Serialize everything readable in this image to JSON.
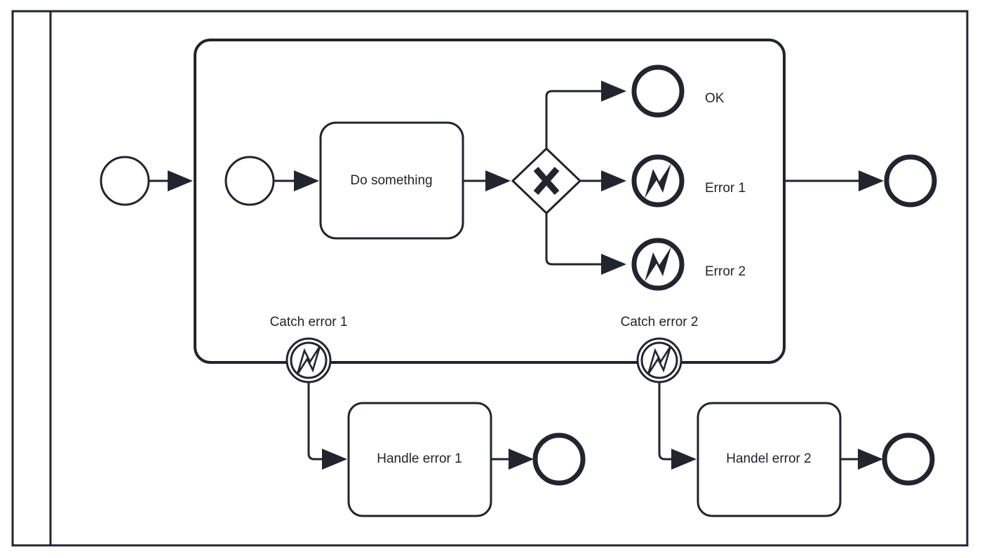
{
  "diagram": {
    "type": "bpmn-process-diagram",
    "notation": "BPMN 2.0",
    "stroke_color": "#22242e",
    "fill_color": "#ffffff",
    "background": "#ffffff"
  },
  "pool": {
    "name": "pool",
    "lane_label": "",
    "has_lane_header": true
  },
  "subprocess": {
    "name": "embedded-subprocess",
    "label": ""
  },
  "events": {
    "outer_start": {
      "label": "",
      "kind": "start-event"
    },
    "sub_start": {
      "label": "",
      "kind": "start-event"
    },
    "end_ok": {
      "label": "OK",
      "kind": "end-event-none"
    },
    "end_error_1": {
      "label": "Error 1",
      "kind": "end-event-error"
    },
    "end_error_2": {
      "label": "Error 2",
      "kind": "end-event-error"
    },
    "boundary_1": {
      "label": "Catch error 1",
      "kind": "boundary-event-error"
    },
    "boundary_2": {
      "label": "Catch error 2",
      "kind": "boundary-event-error"
    },
    "end_handle_1": {
      "label": "",
      "kind": "end-event-none"
    },
    "end_handle_2": {
      "label": "",
      "kind": "end-event-none"
    },
    "end_main": {
      "label": "",
      "kind": "end-event-none"
    }
  },
  "tasks": {
    "do_something": {
      "label": "Do something"
    },
    "handle_error_1": {
      "label": "Handle error 1"
    },
    "handle_error_2": {
      "label": "Handel error 2"
    }
  },
  "gateway": {
    "label": "",
    "marker": "X",
    "kind": "exclusive-gateway"
  },
  "flows": [
    {
      "name": "flow-start-to-subprocess",
      "from": "outer_start",
      "to": "subprocess"
    },
    {
      "name": "flow-substart-to-do-something",
      "from": "sub_start",
      "to": "do_something"
    },
    {
      "name": "flow-do-something-to-gateway",
      "from": "do_something",
      "to": "gateway"
    },
    {
      "name": "flow-gateway-to-ok",
      "from": "gateway",
      "to": "end_ok"
    },
    {
      "name": "flow-gateway-to-error-1",
      "from": "gateway",
      "to": "end_error_1"
    },
    {
      "name": "flow-gateway-to-error-2",
      "from": "gateway",
      "to": "end_error_2"
    },
    {
      "name": "flow-subprocess-to-end",
      "from": "subprocess",
      "to": "end_main"
    },
    {
      "name": "flow-boundary-1-to-handle-1",
      "from": "boundary_1",
      "to": "handle_error_1"
    },
    {
      "name": "flow-handle-1-to-end",
      "from": "handle_error_1",
      "to": "end_handle_1"
    },
    {
      "name": "flow-boundary-2-to-handle-2",
      "from": "boundary_2",
      "to": "handle_error_2"
    },
    {
      "name": "flow-handle-2-to-end",
      "from": "handle_error_2",
      "to": "end_handle_2"
    }
  ]
}
